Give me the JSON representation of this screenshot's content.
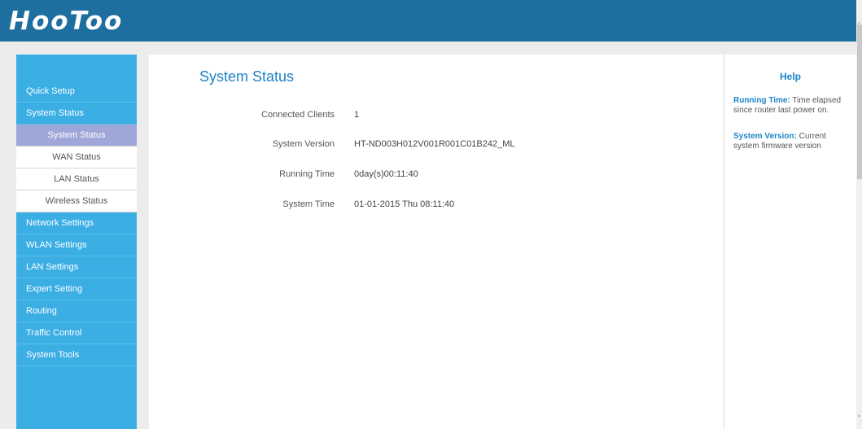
{
  "brand": {
    "logo": "HooToo"
  },
  "sidebar": {
    "items": [
      {
        "label": "Quick Setup"
      },
      {
        "label": "System Status"
      },
      {
        "label": "System Status",
        "sub": true,
        "active": true
      },
      {
        "label": "WAN Status",
        "sub": true
      },
      {
        "label": "LAN Status",
        "sub": true
      },
      {
        "label": "Wireless Status",
        "sub": true
      },
      {
        "label": "Network Settings"
      },
      {
        "label": "WLAN Settings"
      },
      {
        "label": "LAN Settings"
      },
      {
        "label": "Expert Setting"
      },
      {
        "label": "Routing"
      },
      {
        "label": "Traffic Control"
      },
      {
        "label": "System Tools"
      }
    ]
  },
  "main": {
    "title": "System Status",
    "rows": [
      {
        "label": "Connected Clients",
        "value": "1"
      },
      {
        "label": "System Version",
        "value": "HT-ND003H012V001R001C01B242_ML"
      },
      {
        "label": "Running Time",
        "value": "0day(s)00:11:40"
      },
      {
        "label": "System Time",
        "value": "01-01-2015 Thu 08:11:40"
      }
    ]
  },
  "help": {
    "title": "Help",
    "entries": [
      {
        "term": "Running Time:",
        "text": " Time elapsed since router last power on."
      },
      {
        "term": "System Version:",
        "text": " Current system firmware version"
      }
    ]
  },
  "colors": {
    "header": "#1f6ea0",
    "sidebar": "#3baee4",
    "active_sub": "#9fa6d8",
    "accent": "#1d84c6"
  },
  "icons": {
    "scroll_up": "chevron-up-icon",
    "scroll_down": "chevron-down-icon"
  }
}
